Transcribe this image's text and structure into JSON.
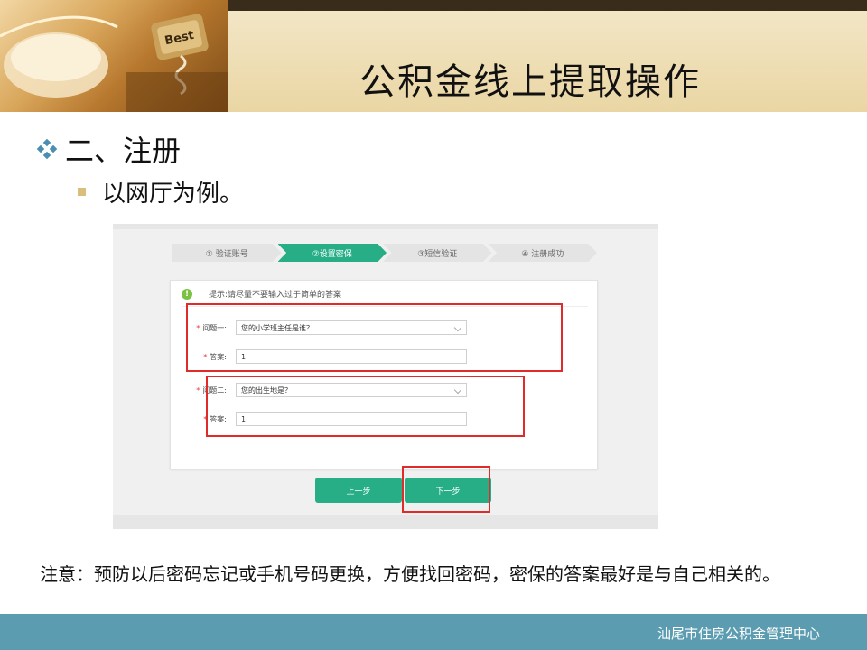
{
  "header": {
    "title": "公积金线上提取操作",
    "photo_key_label": "Best"
  },
  "bullets": {
    "level1": "二、注册",
    "level2": "以网厅为例。"
  },
  "screenshot": {
    "steps": [
      {
        "label": "① 验证账号",
        "active": false
      },
      {
        "label": "②设置密保",
        "active": true
      },
      {
        "label": "③短信验证",
        "active": false
      },
      {
        "label": "④ 注册成功",
        "active": false
      }
    ],
    "tip": "提示:请尽量不要输入过于简单的答案",
    "tip_icon": "!",
    "question1": {
      "required_mark": "*",
      "label": "问题一:",
      "value": "您的小学班主任是谁？"
    },
    "answer1": {
      "required_mark": "*",
      "label": "答案:",
      "value": "1"
    },
    "question2": {
      "required_mark": "*",
      "label": "问题二:",
      "value": "您的出生地是？"
    },
    "answer2": {
      "required_mark": "*",
      "label": "答案:",
      "value": "1"
    },
    "prev_button": "上一步",
    "next_button": "下一步"
  },
  "note": "注意：预防以后密码忘记或手机号码更换，方便找回密码，密保的答案最好是与自己相关的。",
  "footer": {
    "org": "汕尾市住房公积金管理中心"
  },
  "colors": {
    "header_band": "#ead6a4",
    "header_topbar": "#3a2c1a",
    "accent_green": "#27ae86",
    "highlight_red": "#e02b2b",
    "footer_bar": "#5b9cb1"
  }
}
